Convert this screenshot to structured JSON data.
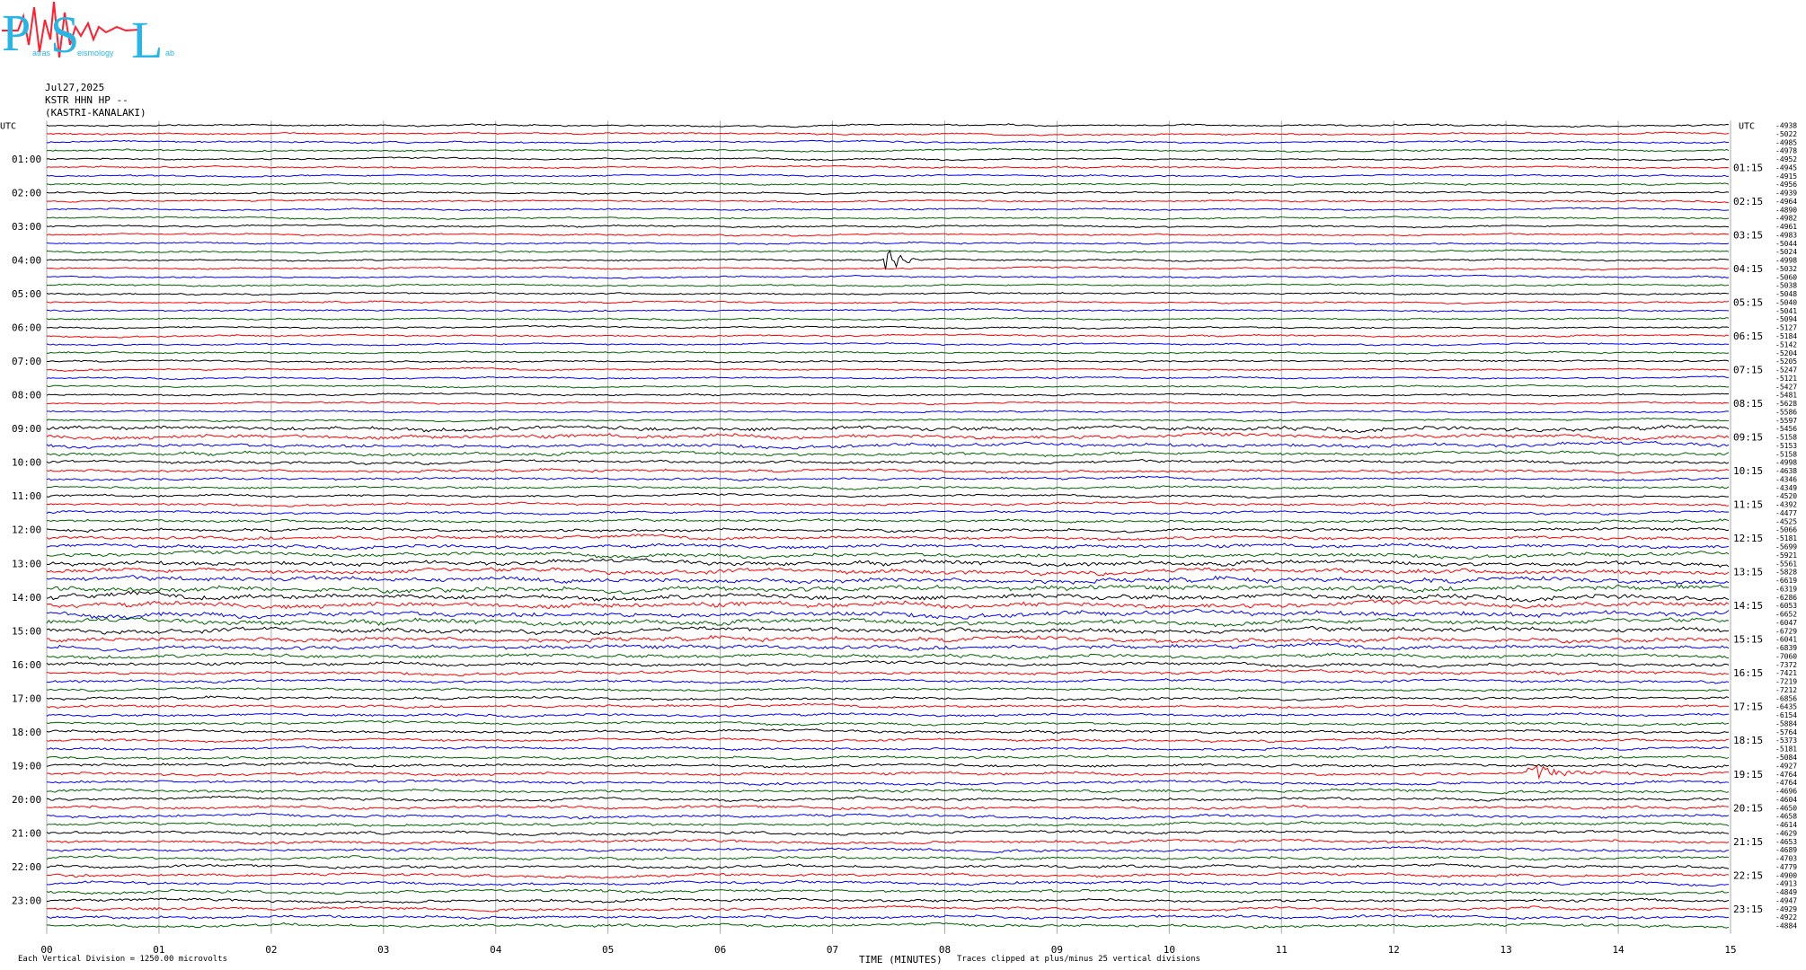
{
  "logo": {
    "letters": [
      "P",
      "S",
      "L"
    ],
    "subtext": [
      "atras",
      "eismology",
      "ab"
    ],
    "colors": {
      "letters": "#29b6e6",
      "seismo": "#ff2030"
    }
  },
  "header": {
    "date": "Jul27,2025",
    "station": "KSTR HHN HP --",
    "location": "(KASTRI-KANALAKI)"
  },
  "footer": {
    "left": "Each Vertical Division = 1250.00 microvolts",
    "center": "TIME (MINUTES)",
    "right": "Traces clipped at plus/minus 25 vertical divisions"
  },
  "chart_data": {
    "type": "line",
    "xlabel": "TIME (MINUTES)",
    "xlim": [
      0,
      15
    ],
    "x_ticks": [
      "00",
      "01",
      "02",
      "03",
      "04",
      "05",
      "06",
      "07",
      "08",
      "09",
      "10",
      "11",
      "12",
      "13",
      "14",
      "15"
    ],
    "left_axis_title": "UTC",
    "right_axis_title": "UTC",
    "left_labels": [
      "01:00",
      "02:00",
      "03:00",
      "04:00",
      "05:00",
      "06:00",
      "07:00",
      "08:00",
      "09:00",
      "10:00",
      "11:00",
      "12:00",
      "13:00",
      "14:00",
      "15:00",
      "16:00",
      "17:00",
      "18:00",
      "19:00",
      "20:00",
      "21:00",
      "22:00",
      "23:00"
    ],
    "right_labels": [
      "01:15",
      "02:15",
      "03:15",
      "04:15",
      "05:15",
      "06:15",
      "07:15",
      "08:15",
      "09:15",
      "10:15",
      "11:15",
      "12:15",
      "13:15",
      "14:15",
      "15:15",
      "16:15",
      "17:15",
      "18:15",
      "19:15",
      "20:15",
      "21:15",
      "22:15",
      "23:15"
    ],
    "trace_colors": [
      "#000000",
      "#ff0000",
      "#0000ff",
      "#006400"
    ],
    "traces_per_hour": 4,
    "trace_count": 96,
    "trace_offsets": [
      "-4938",
      "-5022",
      "-4985",
      "-4978",
      "-4952",
      "-4945",
      "-4915",
      "-4956",
      "-4939",
      "-4964",
      "-4890",
      "-4982",
      "-4961",
      "-4983",
      "-5044",
      "-5024",
      "-4998",
      "-5032",
      "-5060",
      "-5038",
      "-5048",
      "-5040",
      "-5041",
      "-5094",
      "-5127",
      "-5184",
      "-5142",
      "-5204",
      "-5205",
      "-5247",
      "-5121",
      "-5427",
      "-5481",
      "-5628",
      "-5586",
      "-5597",
      "-5456",
      "-5158",
      "-5153",
      "-5158",
      "-4998",
      "-4638",
      "-4346",
      "-4349",
      "-4520",
      "-4392",
      "-4477",
      "-4525",
      "-5066",
      "-5181",
      "-5699",
      "-5921",
      "-5561",
      "-5828",
      "-6619",
      "-6319",
      "-6286",
      "-6053",
      "-6652",
      "-6047",
      "-6729",
      "-6041",
      "-6839",
      "-7060",
      "-7372",
      "-7421",
      "-7219",
      "-7212",
      "-6856",
      "-6435",
      "-6154",
      "-5884",
      "-5764",
      "-5373",
      "-5181",
      "-5084",
      "-4927",
      "-4764",
      "-4764",
      "-4696",
      "-4604",
      "-4650",
      "-4658",
      "-4614",
      "-4629",
      "-4653",
      "-4689",
      "-4703",
      "-4779",
      "-4900",
      "-4913",
      "-4849",
      "-4947",
      "-4929",
      "-4922",
      "-4884"
    ],
    "events": [
      {
        "trace": 16,
        "minute": 7.46,
        "amplitude": "large",
        "duration_min": 0.6,
        "color": "#000000"
      },
      {
        "trace": 77,
        "minute": 13.2,
        "amplitude": "medium",
        "duration_min": 1.2,
        "color": "#ff0000"
      }
    ],
    "grid": "vertical-minute-lines",
    "vertical_division": "1250.00 microvolts",
    "clip": "plus/minus 25 vertical divisions"
  }
}
